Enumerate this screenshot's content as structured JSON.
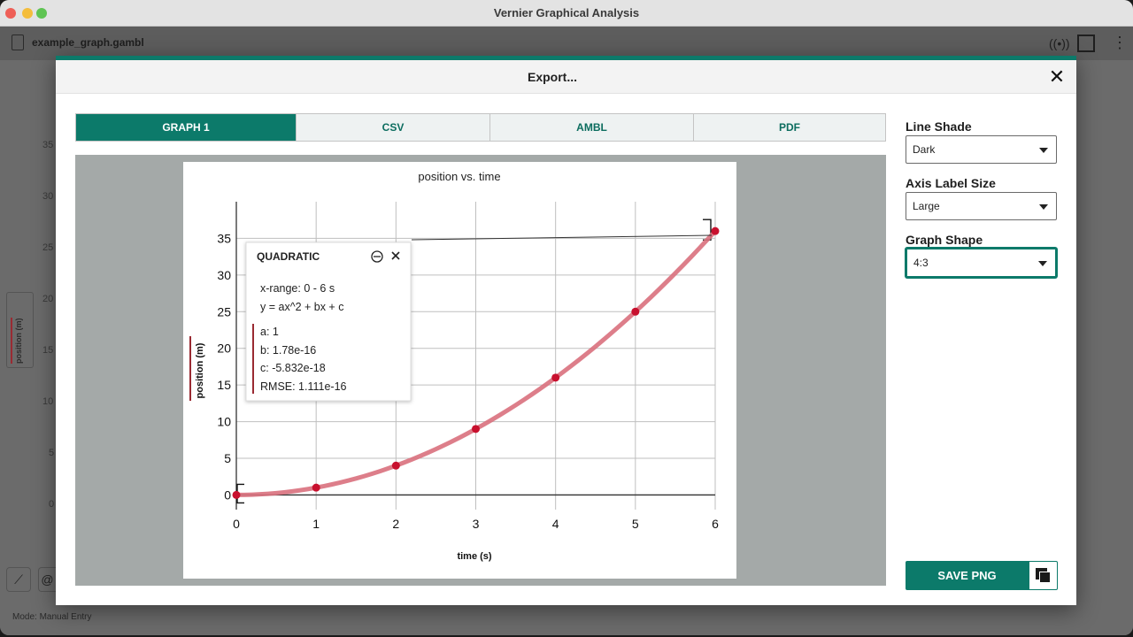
{
  "window": {
    "title": "Vernier Graphical Analysis"
  },
  "toolbar": {
    "file_name": "example_graph.gambl",
    "icons": [
      "sensor-icon",
      "layout-icon",
      "more-icon"
    ]
  },
  "background": {
    "y_ticks": [
      "35",
      "30",
      "25",
      "20",
      "15",
      "10",
      "5",
      "0"
    ],
    "ylabel": "position (m)",
    "status": "Mode: Manual Entry"
  },
  "dialog": {
    "title": "Export...",
    "close_symbol": "✕",
    "tabs": [
      {
        "label": "GRAPH 1",
        "active": true
      },
      {
        "label": "CSV",
        "active": false
      },
      {
        "label": "AMBL",
        "active": false
      },
      {
        "label": "PDF",
        "active": false
      }
    ],
    "options": {
      "line_shade": {
        "label": "Line Shade",
        "value": "Dark"
      },
      "axis_label_size": {
        "label": "Axis Label Size",
        "value": "Large"
      },
      "graph_shape": {
        "label": "Graph Shape",
        "value": "4:3"
      }
    },
    "save_label": "SAVE PNG"
  },
  "fit_box": {
    "title": "QUADRATIC",
    "range": "x-range: 0 - 6 s",
    "equation": "y = ax^2 + bx + c",
    "params": [
      "a: 1",
      "b: 1.78e-16",
      "c: -5.832e-18",
      "RMSE: 1.111e-16"
    ]
  },
  "colors": {
    "accent": "#0c7a6a",
    "data": "#c8102e",
    "fit": "#d9707d"
  },
  "chart_data": {
    "type": "scatter",
    "title": "position vs. time",
    "xlabel": "time (s)",
    "ylabel": "position (m)",
    "xlim": [
      0,
      6
    ],
    "ylim": [
      -2,
      40
    ],
    "x_ticks": [
      0,
      1,
      2,
      3,
      4,
      5,
      6
    ],
    "y_ticks": [
      0,
      5,
      10,
      15,
      20,
      25,
      30,
      35
    ],
    "grid": true,
    "x": [
      0,
      1,
      2,
      3,
      4,
      5,
      6
    ],
    "y": [
      0,
      1,
      4,
      9,
      16,
      25,
      36
    ],
    "fit": {
      "type": "quadratic",
      "a": 1,
      "b": 1.78e-16,
      "c": -5.832e-18
    }
  }
}
